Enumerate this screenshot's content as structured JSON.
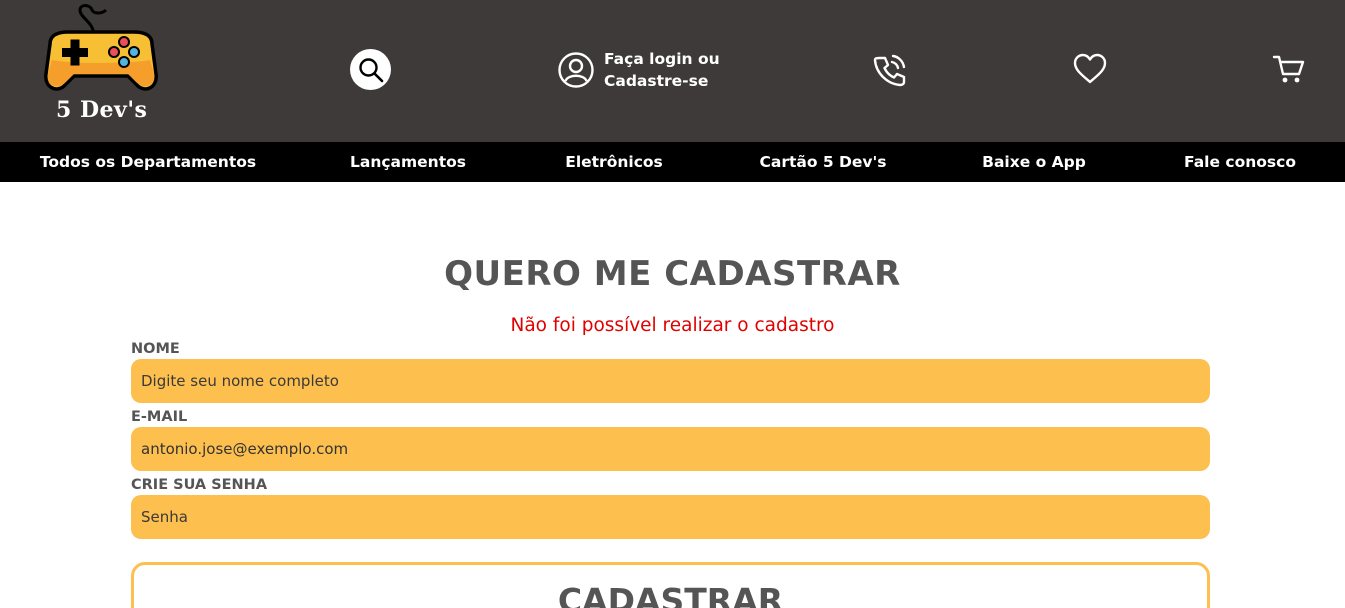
{
  "header": {
    "logo_text": "5 Dev's",
    "login_line1": "Faça login ou",
    "login_line2": "Cadastre-se"
  },
  "nav": {
    "items": [
      "Todos os Departamentos",
      "Lançamentos",
      "Eletrônicos",
      "Cartão 5 Dev's",
      "Baixe o App",
      "Fale conosco"
    ]
  },
  "form": {
    "title": "QUERO ME CADASTRAR",
    "error": "Não foi possível realizar o cadastro",
    "name_label": "NOME",
    "name_placeholder": "Digite seu nome completo",
    "name_value": "",
    "email_label": "E-MAIL",
    "email_placeholder": "",
    "email_value": "antonio.jose@exemplo.com",
    "password_label": "CRIE SUA SENHA",
    "password_placeholder": "Senha",
    "password_value": "",
    "submit_label": "CADASTRAR"
  },
  "colors": {
    "header_bg": "#3e3a39",
    "nav_bg": "#000000",
    "accent": "#fdbf4e",
    "error": "#e00000",
    "text": "#555555"
  },
  "icons": {
    "logo": "gamepad-icon",
    "search": "search-icon",
    "user": "user-icon",
    "phone": "phone-icon",
    "favorites": "heart-icon",
    "cart": "cart-icon"
  }
}
